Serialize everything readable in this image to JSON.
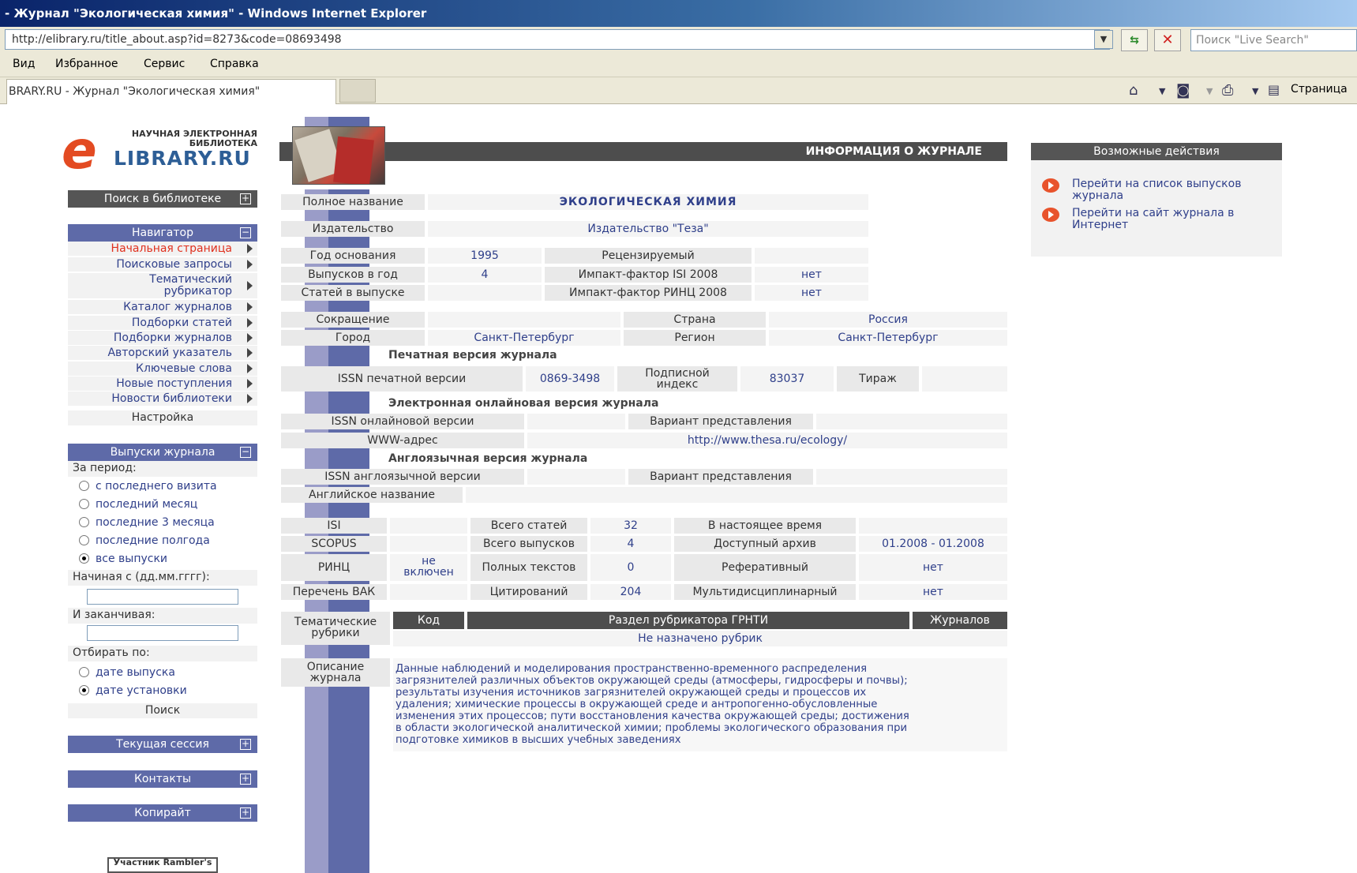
{
  "browser": {
    "title": "- Журнал \"Экологическая химия\" - Windows Internet Explorer",
    "url": "http://elibrary.ru/title_about.asp?id=8273&code=08693498",
    "search_placeholder": "Поиск \"Live Search\"",
    "menu": [
      "Вид",
      "Избранное",
      "Сервис",
      "Справка"
    ],
    "tab_title": "BRARY.RU - Журнал \"Экологическая химия\"",
    "page_menu": "Страница"
  },
  "logo": {
    "small_line1": "НАУЧНАЯ ЭЛЕКТРОННАЯ",
    "small_line2": "БИБЛИОТЕКА",
    "main": "LIBRARY.RU",
    "letter": "e"
  },
  "sidebar": {
    "search_title": "Поиск в библиотеке",
    "navigator_title": "Навигатор",
    "nav_items": [
      "Начальная страница",
      "Поисковые запросы",
      "Тематический рубрикатор",
      "Каталог журналов",
      "Подборки статей",
      "Подборки журналов",
      "Авторский указатель",
      "Ключевые слова",
      "Новые поступления",
      "Новости библиотеки"
    ],
    "settings": "Настройка",
    "issues_title": "Выпуски журнала",
    "period_label": "За период:",
    "period_options": [
      "с последнего визита",
      "последний месяц",
      "последние 3 месяца",
      "последние полгода",
      "все выпуски"
    ],
    "period_selected": "все выпуски",
    "start_label": "Начиная с (дд.мм.гггг):",
    "end_label": "И заканчивая:",
    "sort_label": "Отбирать по:",
    "sort_options": [
      "дате выпуска",
      "дате установки"
    ],
    "sort_selected": "дате установки",
    "search_button": "Поиск",
    "session_title": "Текущая сессия",
    "contacts_title": "Контакты",
    "copyright_title": "Копирайт",
    "rambler": "Участник Rambler's"
  },
  "info": {
    "header": "ИНФОРМАЦИЯ О ЖУРНАЛЕ",
    "full_name_label": "Полное название",
    "full_name": "ЭКОЛОГИЧЕСКАЯ ХИМИЯ",
    "publisher_label": "Издательство",
    "publisher": "Издательство \"Теза\"",
    "founded_label": "Год основания",
    "founded": "1995",
    "reviewed_label": "Рецензируемый",
    "reviewed": "",
    "issues_per_year_label": "Выпусков в год",
    "issues_per_year": "4",
    "isi_if_label": "Импакт-фактор ISI 2008",
    "isi_if": "нет",
    "articles_per_issue_label": "Статей в выпуске",
    "articles_per_issue": "",
    "rinc_if_label": "Импакт-фактор РИНЦ 2008",
    "rinc_if": "нет",
    "abbr_label": "Сокращение",
    "abbr": "",
    "country_label": "Страна",
    "country": "Россия",
    "city_label": "Город",
    "city": "Санкт-Петербург",
    "region_label": "Регион",
    "region": "Санкт-Петербург",
    "print_title": "Печатная версия журнала",
    "issn_print_label": "ISSN печатной версии",
    "issn_print": "0869-3498",
    "subscr_label": "Подписной индекс",
    "subscr": "83037",
    "circulation_label": "Тираж",
    "circulation": "",
    "online_title": "Электронная онлайновая версия журнала",
    "issn_online_label": "ISSN онлайновой версии",
    "issn_online": "",
    "variant_label": "Вариант представления",
    "variant": "",
    "www_label": "WWW-адрес",
    "www": "http://www.thesa.ru/ecology/",
    "english_title": "Англоязычная версия журнала",
    "issn_english_label": "ISSN англоязычной версии",
    "issn_english": "",
    "variant2_label": "Вариант представления",
    "variant2": "",
    "english_name_label": "Английское название",
    "english_name": ""
  },
  "stats": {
    "rows": [
      {
        "db": "ISI",
        "db_val": "",
        "l2": "Всего статей",
        "v2": "32",
        "l3": "В настоящее время",
        "v3": ""
      },
      {
        "db": "SCOPUS",
        "db_val": "",
        "l2": "Всего выпусков",
        "v2": "4",
        "l3": "Доступный архив",
        "v3": "01.2008 - 01.2008"
      },
      {
        "db": "РИНЦ",
        "db_val": "не включен",
        "l2": "Полных текстов",
        "v2": "0",
        "l3": "Реферативный",
        "v3": "нет"
      },
      {
        "db": "Перечень ВАК",
        "db_val": "",
        "l2": "Цитирований",
        "v2": "204",
        "l3": "Мультидисциплинарный",
        "v3": "нет"
      }
    ]
  },
  "rubrics": {
    "label": "Тематические рубрики",
    "col_code": "Код",
    "col_section": "Раздел рубрикатора ГРНТИ",
    "col_journals": "Журналов",
    "empty": "Не назначено рубрик"
  },
  "description": {
    "label": "Описание журнала",
    "lines": [
      "Данные наблюдений и моделирования пространственно-временного распределения",
      "загрязнителей различных объектов окружающей среды (атмосферы, гидросферы и почвы);",
      "результаты изучения источников загрязнителей окружающей среды и процессов их",
      "удаления; химические процессы в окружающей среде и антропогенно-обусловленные",
      "изменения этих процессов; пути восстановления качества окружающей среды; достижения",
      "в области экологической аналитической химии; проблемы экологического образования при",
      "подготовке химиков в высших учебных заведениях"
    ]
  },
  "actions": {
    "title": "Возможные действия",
    "items": [
      "Перейти на список выпусков журнала",
      "Перейти на сайт журнала в Интернет"
    ]
  },
  "colors": {
    "accent_blue": "#5e6aa8",
    "header_gray": "#4d4d4d",
    "link_blue": "#2f3f8a",
    "active_red": "#e0301e",
    "logo_orange": "#e34b22"
  }
}
